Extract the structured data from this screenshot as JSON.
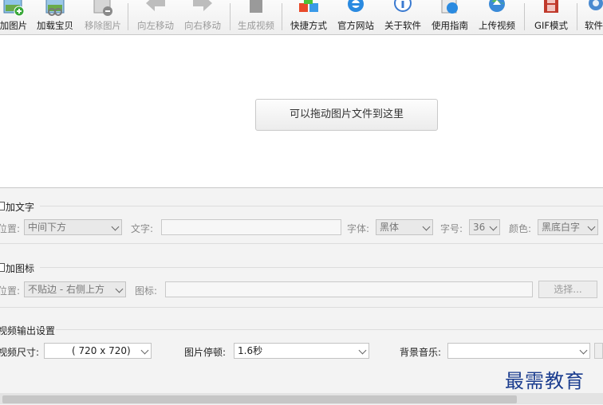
{
  "toolbar": {
    "buttons": [
      {
        "label": "加图片",
        "icon": "add-image-icon",
        "disabled": false
      },
      {
        "label": "加载宝贝",
        "icon": "load-items-icon",
        "disabled": false
      },
      {
        "label": "移除图片",
        "icon": "remove-image-icon",
        "disabled": true
      },
      {
        "label": "向左移动",
        "icon": "arrow-left-icon",
        "disabled": true
      },
      {
        "label": "向右移动",
        "icon": "arrow-right-icon",
        "disabled": true
      },
      {
        "label": "生成视频",
        "icon": "clapperboard-icon",
        "disabled": true
      },
      {
        "label": "快捷方式",
        "icon": "cubes-icon",
        "disabled": false
      },
      {
        "label": "官方网站",
        "icon": "ie-browser-icon",
        "disabled": false
      },
      {
        "label": "关于软件",
        "icon": "info-icon",
        "disabled": false
      },
      {
        "label": "使用指南",
        "icon": "guide-icon",
        "disabled": false
      },
      {
        "label": "上传视频",
        "icon": "upload-globe-icon",
        "disabled": false
      },
      {
        "label": "GIF模式",
        "icon": "film-strip-icon",
        "disabled": false
      },
      {
        "label": "软件",
        "icon": "gear-icon",
        "disabled": false
      }
    ]
  },
  "drop": {
    "label": "可以拖动图片文件到这里"
  },
  "text_section": {
    "title": "加文字",
    "position_label": "位置:",
    "position_value": "中间下方",
    "text_label": "文字:",
    "font_label": "字体:",
    "font_value": "黑体",
    "size_label": "字号:",
    "size_value": "36",
    "color_label": "颜色:",
    "color_value": "黑底白字"
  },
  "icon_section": {
    "title": "加图标",
    "position_label": "位置:",
    "position_value": "不贴边 - 右侧上方",
    "icon_label": "图标:",
    "choose_label": "选择..."
  },
  "output_section": {
    "title": "视频输出设置",
    "size_label": "视频尺寸:",
    "size_value": "( 720 x  720)",
    "pause_label": "图片停顿:",
    "pause_value": "1.6秒",
    "music_label": "背景音乐:",
    "music_value": ""
  },
  "watermark": {
    "text": "最需教育"
  }
}
